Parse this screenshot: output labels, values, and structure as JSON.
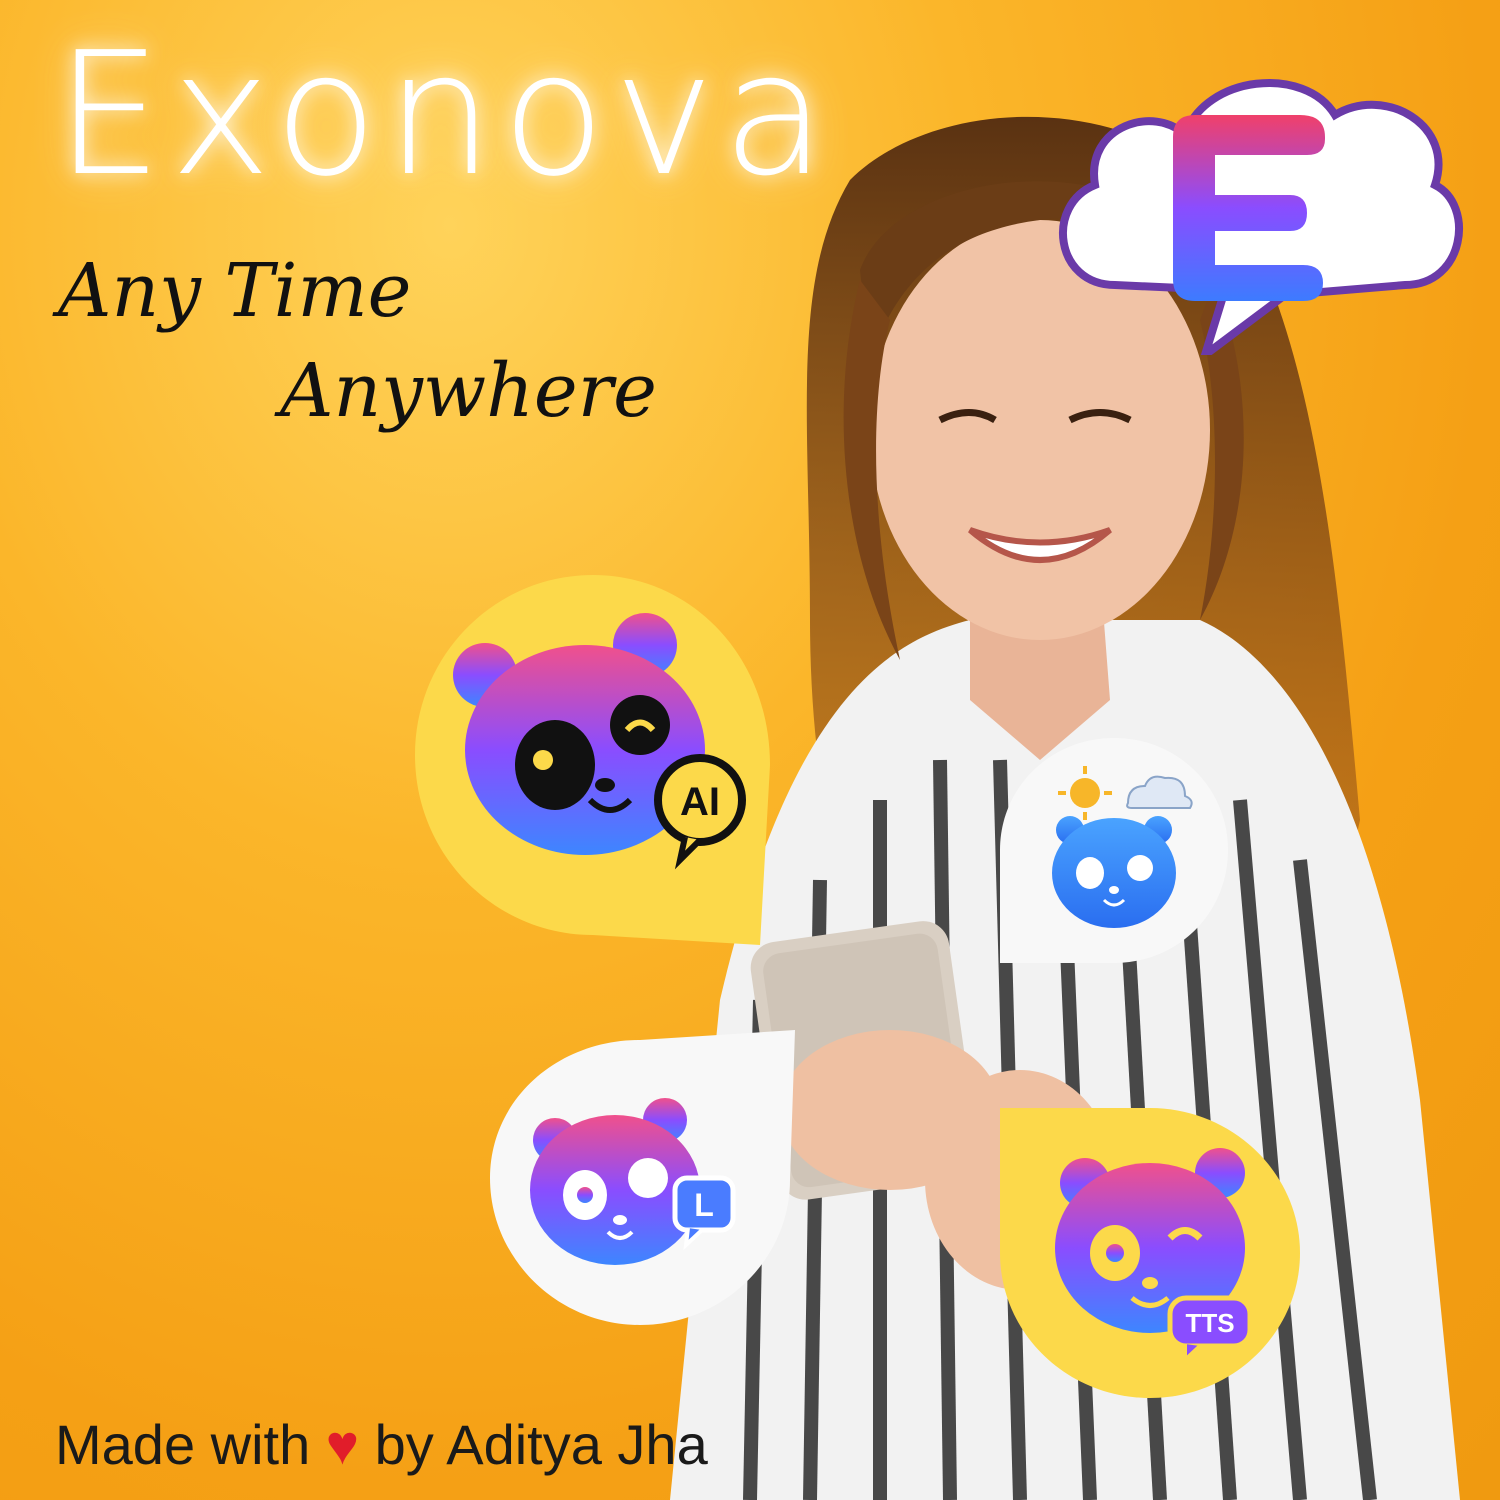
{
  "brand": {
    "title": "Exonova",
    "tagline_line1": "Any Time",
    "tagline_line2": "Anywhere",
    "logo_letter": "E"
  },
  "footer": {
    "prefix": "Made with",
    "heart": "♥",
    "suffix": "by Aditya Jha"
  },
  "apps": [
    {
      "badge": "AI",
      "bubble_color": "#fcd94a"
    },
    {
      "badge": "",
      "bubble_color": "#f8f8f8"
    },
    {
      "badge": "L",
      "bubble_color": "#f8f8f8"
    },
    {
      "badge": "TTS",
      "bubble_color": "#fcd94a"
    }
  ]
}
